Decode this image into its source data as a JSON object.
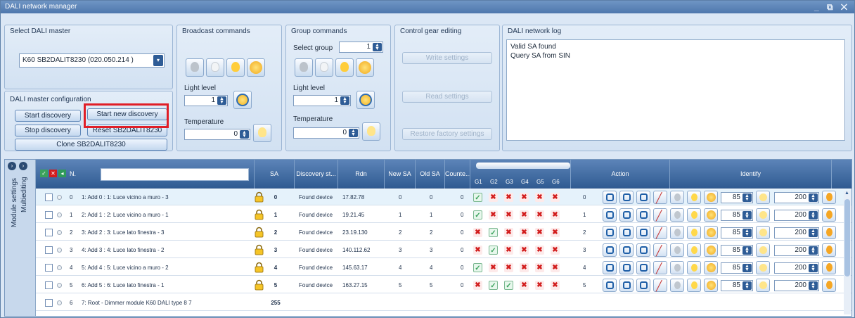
{
  "window": {
    "title": "DALI network manager",
    "controls": "_ ⧉ ✕"
  },
  "master": {
    "title": "Select DALI master",
    "selected": "K60 SB2DALIT8230 (020.050.214 )"
  },
  "config": {
    "title": "DALI master configuration",
    "start": "Start discovery",
    "start_new": "Start new discovery",
    "stop": "Stop discovery",
    "reset": "Reset SB2DALIT8230",
    "clone": "Clone SB2DALIT8230"
  },
  "broadcast": {
    "title": "Broadcast commands",
    "light_label": "Light level",
    "light_value": "1",
    "temp_label": "Temperature",
    "temp_value": "0"
  },
  "group": {
    "title": "Group commands",
    "select_label": "Select group",
    "select_value": "1",
    "light_label": "Light level",
    "light_value": "1",
    "temp_label": "Temperature",
    "temp_value": "0"
  },
  "gear": {
    "title": "Control gear editing",
    "write": "Write settings",
    "read": "Read settings",
    "restore": "Restore factory settings"
  },
  "log": {
    "title": "DALI network log",
    "lines": [
      "Valid SA found",
      "Query SA from SIN"
    ]
  },
  "side": {
    "module": "Module settings",
    "multi": "Multiediting"
  },
  "grid": {
    "headers": {
      "n": "N.",
      "sa": "SA",
      "disc": "Discovery st...",
      "rdn": "Rdn",
      "newsa": "New SA",
      "oldsa": "Old SA",
      "count": "Counte...",
      "groups": [
        "G1",
        "G2",
        "G3",
        "G4",
        "G5",
        "G6"
      ],
      "action": "Action",
      "identify": "Identify"
    },
    "rows": [
      {
        "n": "0",
        "name": "1: Add 0 : 1: Luce vicino a muro - 3",
        "sa": "0",
        "disc": "Found device",
        "rdn": "17.82.78",
        "newsa": "0",
        "oldsa": "0",
        "count": "0",
        "g": [
          "c",
          "x",
          "x",
          "x",
          "x",
          "x"
        ],
        "a": "0",
        "v1": "85",
        "v2": "200"
      },
      {
        "n": "1",
        "name": "2: Add 1 : 2: Luce vicino a muro - 1",
        "sa": "1",
        "disc": "Found device",
        "rdn": "19.21.45",
        "newsa": "1",
        "oldsa": "1",
        "count": "0",
        "g": [
          "c",
          "x",
          "x",
          "x",
          "x",
          "x"
        ],
        "a": "1",
        "v1": "85",
        "v2": "200"
      },
      {
        "n": "2",
        "name": "3: Add 2 : 3: Luce lato finestra - 3",
        "sa": "2",
        "disc": "Found device",
        "rdn": "23.19.130",
        "newsa": "2",
        "oldsa": "2",
        "count": "0",
        "g": [
          "x",
          "c",
          "x",
          "x",
          "x",
          "x"
        ],
        "a": "2",
        "v1": "85",
        "v2": "200"
      },
      {
        "n": "3",
        "name": "4: Add 3 : 4: Luce lato finestra - 2",
        "sa": "3",
        "disc": "Found device",
        "rdn": "140.112.62",
        "newsa": "3",
        "oldsa": "3",
        "count": "0",
        "g": [
          "x",
          "c",
          "x",
          "x",
          "x",
          "x"
        ],
        "a": "3",
        "v1": "85",
        "v2": "200"
      },
      {
        "n": "4",
        "name": "5: Add 4 : 5: Luce vicino a muro - 2",
        "sa": "4",
        "disc": "Found device",
        "rdn": "145.63.17",
        "newsa": "4",
        "oldsa": "4",
        "count": "0",
        "g": [
          "c",
          "x",
          "x",
          "x",
          "x",
          "x"
        ],
        "a": "4",
        "v1": "85",
        "v2": "200"
      },
      {
        "n": "5",
        "name": "6: Add 5 : 6: Luce lato finestra - 1",
        "sa": "5",
        "disc": "Found device",
        "rdn": "163.27.15",
        "newsa": "5",
        "oldsa": "5",
        "count": "0",
        "g": [
          "x",
          "c",
          "c",
          "x",
          "x",
          "x"
        ],
        "a": "5",
        "v1": "85",
        "v2": "200"
      },
      {
        "n": "6",
        "name": "7: Root - Dimmer module K60 DALI type 8 7",
        "sa": "255"
      }
    ]
  },
  "colors": {
    "accent": "#2f5a91",
    "highlight": "#e01e27"
  }
}
